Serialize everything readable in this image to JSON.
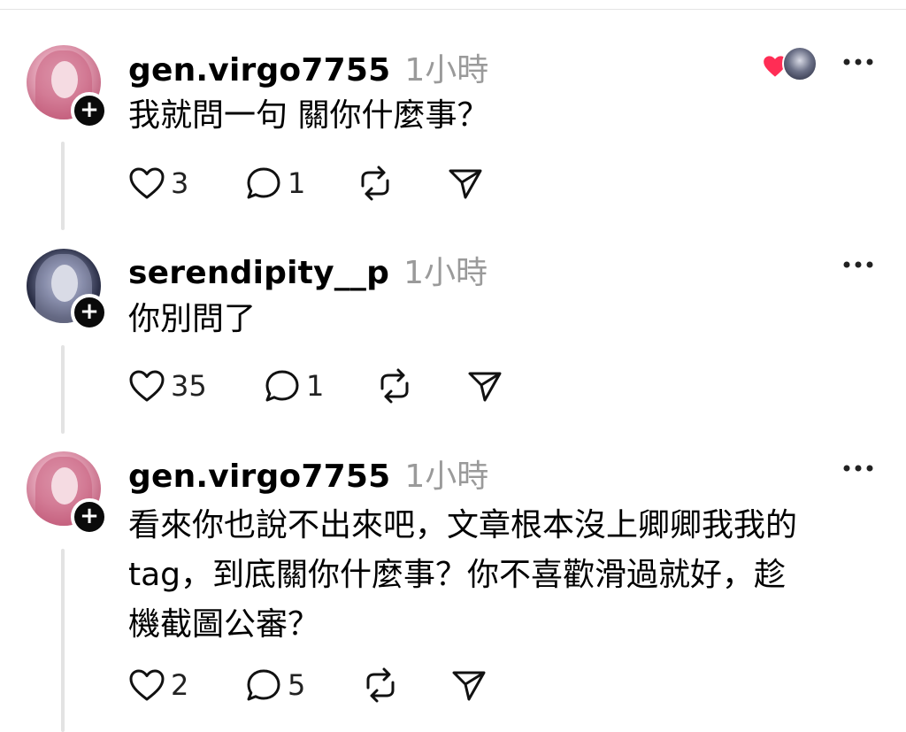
{
  "posts": [
    {
      "username": "gen.virgo7755",
      "time": "1小時",
      "text": "我就問一句 關你什麼事？",
      "likes": "3",
      "replies": "1"
    },
    {
      "username": "serendipity__p",
      "time": "1小時",
      "text": "你別問了",
      "likes": "35",
      "replies": "1"
    },
    {
      "username": "gen.virgo7755",
      "time": "1小時",
      "text_lines": [
        "看來你也說不出來吧，文章根本沒上卿卿我我的",
        "tag，到底關你什麼事？你不喜歡滑過就好，趁",
        "機截圖公審？"
      ],
      "likes": "2",
      "replies": "5"
    }
  ],
  "icons": {
    "like": "heart-outline-icon",
    "reply": "speech-bubble-icon",
    "repost": "repost-arrows-icon",
    "share": "send-paper-plane-icon",
    "more": "more-dots-icon",
    "follow": "plus-icon",
    "liked_by_author": "heart-filled-icon"
  },
  "colors": {
    "accent_heart": "#ff2d55",
    "muted_text": "#9a9a9a",
    "thread_line": "#e3e3e3"
  }
}
